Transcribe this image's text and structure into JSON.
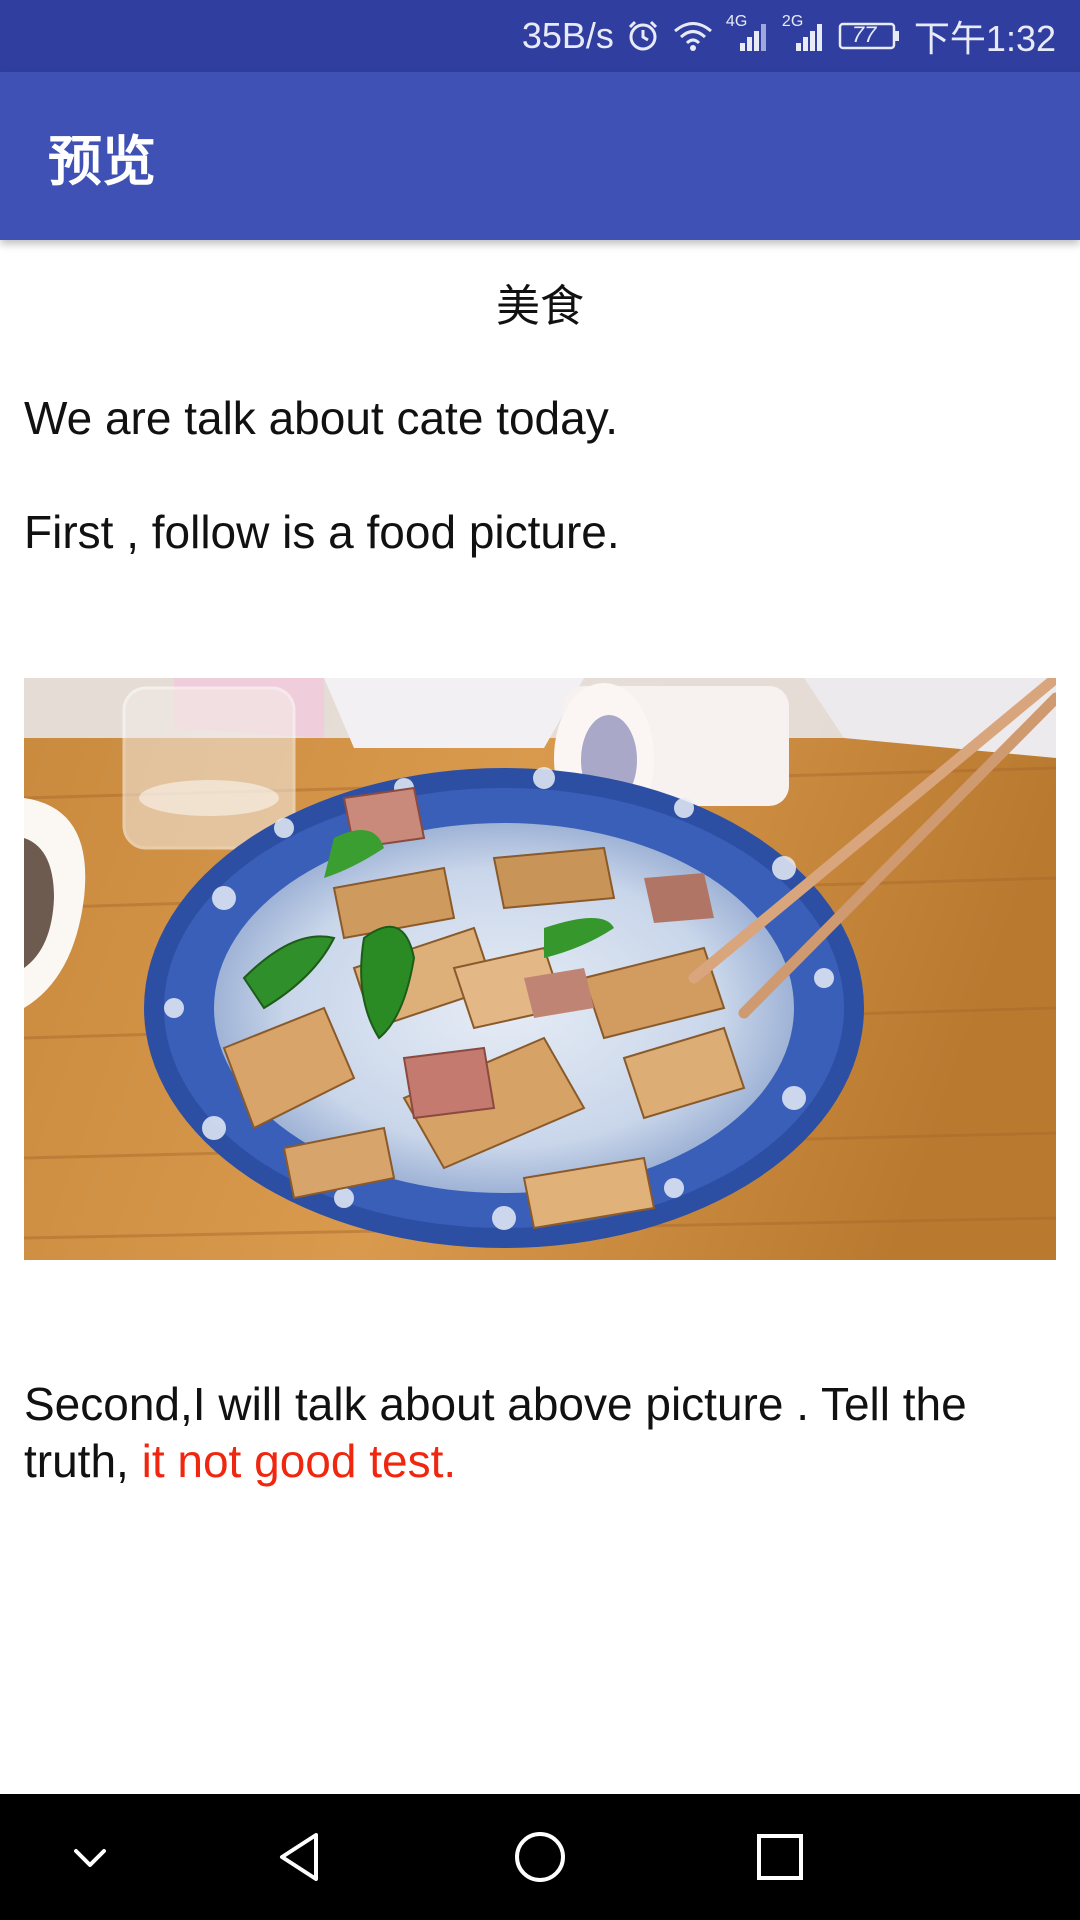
{
  "status_bar": {
    "speed": "35B/s",
    "network1": "4G",
    "network2": "2G",
    "battery": "77",
    "time": "下午1:32",
    "icons": [
      "alarm-icon",
      "wifi-icon",
      "signal-icon",
      "signal-icon",
      "battery-icon"
    ]
  },
  "app_bar": {
    "title": "预览"
  },
  "article": {
    "title": "美食",
    "paragraph1": "We are talk about cate today.",
    "paragraph2": "First , follow is a food picture.",
    "image": "stir-fried tofu skin with pork and green peppers in blue-and-white bowl",
    "paragraph3_normal": "Second,I will talk about above picture . Tell the truth, ",
    "paragraph3_highlight": "it not good test."
  },
  "nav_bar": {
    "icons": [
      "collapse-icon",
      "back-icon",
      "home-icon",
      "recents-icon"
    ]
  },
  "colors": {
    "status_bar": "#303f9f",
    "app_bar": "#3f51b5",
    "highlight": "#f0260f",
    "nav_bar": "#000000"
  }
}
